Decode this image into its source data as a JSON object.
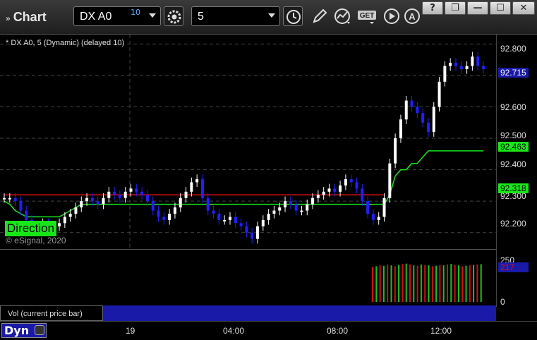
{
  "window": {
    "title": "Chart"
  },
  "toolbar": {
    "symbol": "DX A0",
    "symbol_sup": "10",
    "interval": "5",
    "get_label": "GET"
  },
  "window_buttons": {
    "help": "?",
    "restore": "❐",
    "minimize": "—",
    "maximize": "☐",
    "close": "✕"
  },
  "legend": "* DX A0, 5 (Dynamic) (delayed 10)",
  "direction_label": "Direction",
  "copyright": "© eSignal, 2020",
  "y_axis": {
    "ticks": [
      "92.800",
      "92.600",
      "92.500",
      "92.400",
      "92.300",
      "92.200"
    ],
    "last_price_tag": "92.715",
    "green_tag_1": "92.463",
    "green_tag_2": "92.318"
  },
  "volume": {
    "header": "Vol (current price bar)",
    "close": "✕",
    "ticks": [
      "250",
      "0"
    ],
    "last_tag": "217"
  },
  "x_axis": {
    "ticks": [
      "19",
      "04:00",
      "08:00",
      "12:00"
    ]
  },
  "status": {
    "mode": "Dyn"
  },
  "colors": {
    "red_line": "#e01010",
    "green_line": "#19e619",
    "up_bar": "#ffffff",
    "down_bar": "#2020ff",
    "tag_blue": "#1a1aa8"
  },
  "chart_data": {
    "type": "candlestick",
    "ylim": [
      92.15,
      92.83
    ],
    "close": [
      92.31,
      92.31,
      92.3,
      92.27,
      92.24,
      92.22,
      92.21,
      92.23,
      92.22,
      92.22,
      92.23,
      92.25,
      92.26,
      92.28,
      92.3,
      92.31,
      92.3,
      92.29,
      92.31,
      92.33,
      92.32,
      92.31,
      92.33,
      92.34,
      92.33,
      92.32,
      92.3,
      92.27,
      92.25,
      92.24,
      92.26,
      92.28,
      92.31,
      92.33,
      92.36,
      92.37,
      92.31,
      92.27,
      92.26,
      92.24,
      92.24,
      92.25,
      92.23,
      92.22,
      92.2,
      92.18,
      92.22,
      92.24,
      92.26,
      92.27,
      92.28,
      92.3,
      92.29,
      92.27,
      92.27,
      92.29,
      92.31,
      92.32,
      92.33,
      92.34,
      92.33,
      92.35,
      92.37,
      92.36,
      92.34,
      92.3,
      92.26,
      92.24,
      92.25,
      92.31,
      92.42,
      92.5,
      92.56,
      92.62,
      92.6,
      92.58,
      92.55,
      92.52,
      92.6,
      92.68,
      92.73,
      92.74,
      92.73,
      92.72,
      92.73,
      92.76,
      92.73,
      92.72
    ],
    "red_line": [
      92.32,
      92.32,
      92.32,
      92.32,
      92.32,
      92.32,
      92.32,
      92.32,
      92.32,
      92.32,
      92.32,
      92.32,
      92.32,
      92.32,
      92.32,
      92.32,
      92.32,
      92.32,
      92.32,
      92.32,
      92.32,
      92.32,
      92.32,
      92.32,
      92.32,
      92.32,
      92.32,
      92.32,
      92.32,
      92.32,
      92.32,
      92.32,
      92.32,
      92.32,
      92.32,
      92.32,
      92.32,
      92.32,
      92.32,
      92.32,
      92.32,
      92.32,
      92.32,
      92.32,
      92.32,
      92.32,
      92.32,
      92.32,
      92.32,
      92.32,
      92.32,
      92.32,
      92.32,
      92.32,
      92.32,
      92.32,
      92.32,
      92.32,
      92.32,
      92.32,
      92.32,
      92.32,
      92.32,
      92.32,
      92.32,
      92.32,
      92.32,
      92.32,
      92.32,
      92.32
    ],
    "green_line": [
      92.3,
      92.29,
      92.27,
      92.26,
      92.25,
      92.25,
      92.25,
      92.25,
      92.25,
      92.25,
      92.25,
      92.26,
      92.27,
      92.28,
      92.29,
      92.29,
      92.29,
      92.29,
      92.29,
      92.29,
      92.29,
      92.29,
      92.29,
      92.29,
      92.29,
      92.29,
      92.29,
      92.29,
      92.29,
      92.29,
      92.29,
      92.29,
      92.29,
      92.29,
      92.29,
      92.29,
      92.29,
      92.29,
      92.29,
      92.29,
      92.29,
      92.29,
      92.29,
      92.29,
      92.29,
      92.29,
      92.29,
      92.29,
      92.29,
      92.29,
      92.29,
      92.29,
      92.29,
      92.29,
      92.29,
      92.29,
      92.29,
      92.29,
      92.29,
      92.29,
      92.29,
      92.29,
      92.29,
      92.29,
      92.29,
      92.29,
      92.29,
      92.29,
      92.29,
      92.29,
      92.32,
      92.38,
      92.4,
      92.4,
      92.42,
      92.42,
      92.44,
      92.46,
      92.46,
      92.46,
      92.46,
      92.46,
      92.46,
      92.46,
      92.46,
      92.46,
      92.46,
      92.46
    ],
    "volume": [
      200,
      205,
      210,
      208,
      215,
      210,
      205,
      212,
      218,
      220,
      215,
      210,
      208,
      215,
      212,
      210,
      205,
      208,
      212,
      210,
      215,
      218,
      212,
      210,
      205,
      208,
      210,
      212,
      215,
      217
    ]
  }
}
